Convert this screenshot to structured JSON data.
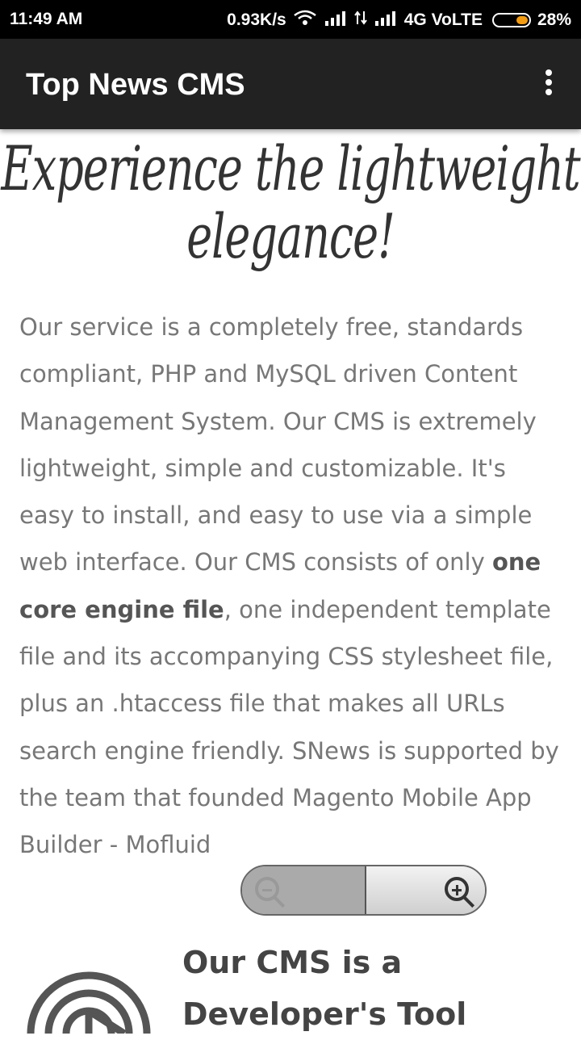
{
  "status_bar": {
    "time": "11:49 AM",
    "net_speed": "0.93K/s",
    "network": "4G VoLTE",
    "battery": "28%",
    "battery_level": 0.28
  },
  "app_bar": {
    "title": "Top News CMS",
    "menu_icon": "more-vert-icon"
  },
  "content": {
    "headline": "Experience the lightweight elegance!",
    "intro_before_bold": "Our service is a completely free, standards compliant, PHP and MySQL driven Content Management System. Our CMS is extremely lightweight, simple and customizable. It's easy to install, and easy to use via a simple web interface. Our CMS consists of only ",
    "intro_bold": "one core engine file",
    "intro_after_bold": ", one independent template file and its accompanying CSS stylesheet file, plus an .htaccess file that makes all URLs search engine friendly. SNews is supported by the team that founded Magento Mobile App Builder - Mofluid",
    "feature_title": "Our CMS is a Developer's Tool"
  },
  "zoom": {
    "zoom_out_icon": "zoom-out-icon",
    "zoom_in_icon": "zoom-in-icon"
  }
}
